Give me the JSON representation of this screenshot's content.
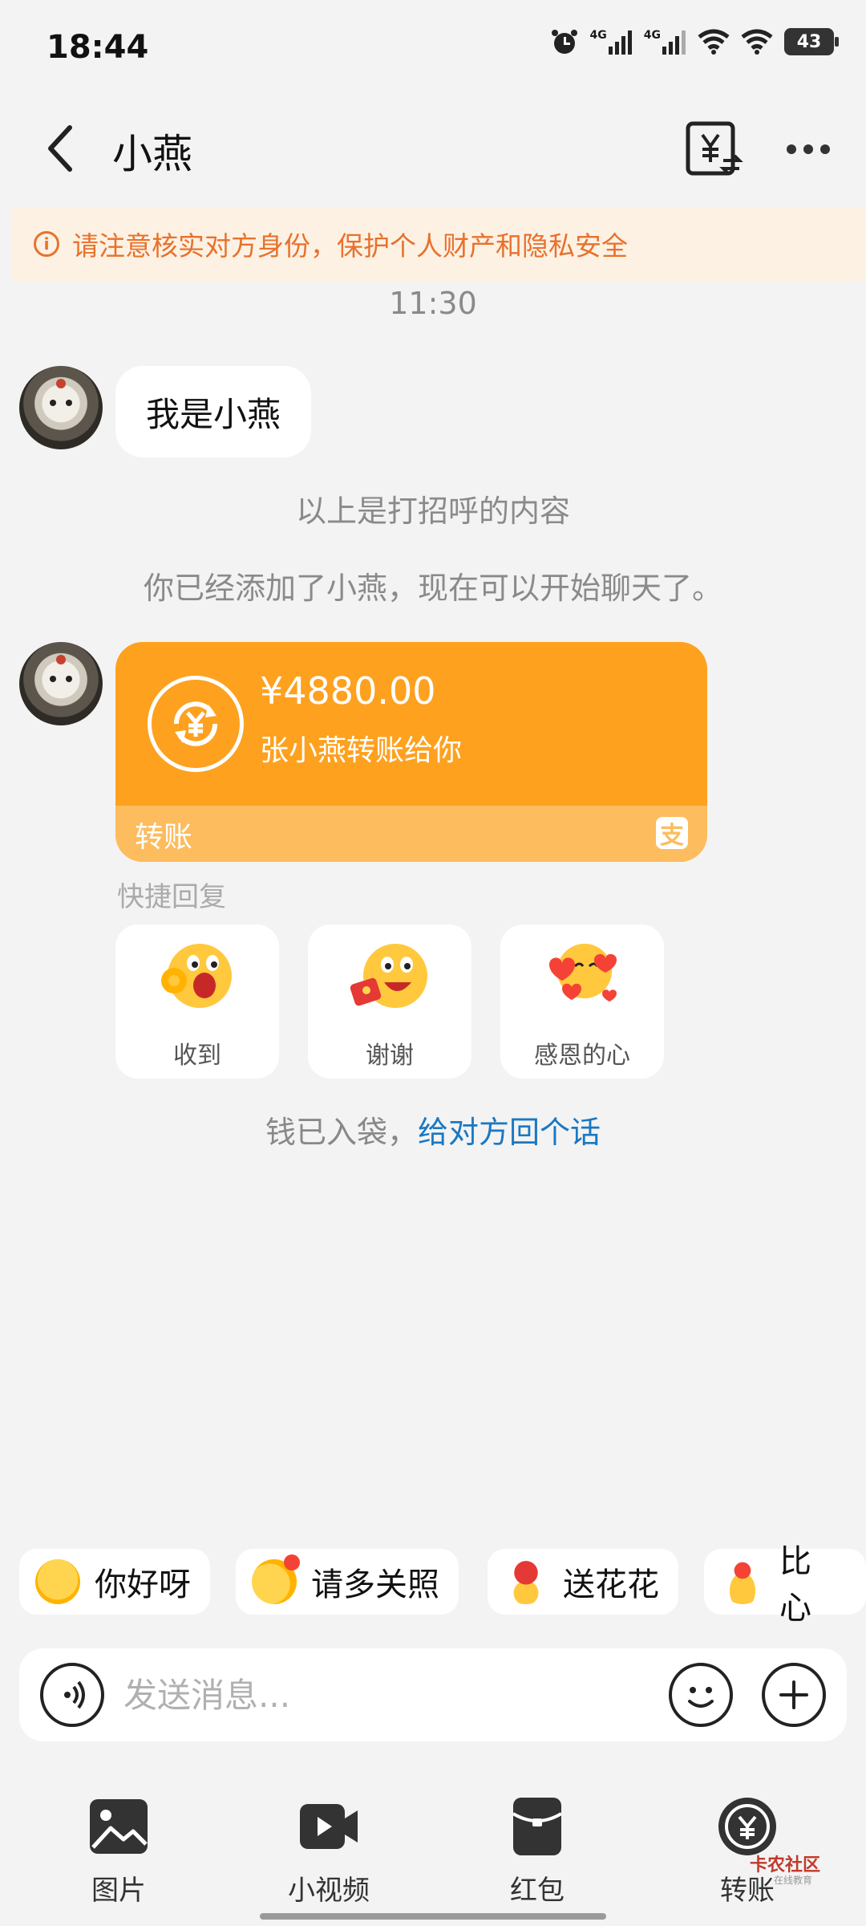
{
  "status_bar": {
    "time": "18:44",
    "battery": "43",
    "network_1": "4G",
    "network_2": "4G"
  },
  "nav": {
    "title": "小燕"
  },
  "warning": {
    "text": "请注意核实对方身份，保护个人财产和隐私安全"
  },
  "chat": {
    "timestamp": "11:30",
    "greeting_message": "我是小燕",
    "system_msg_1": "以上是打招呼的内容",
    "system_msg_2": "你已经添加了小燕，现在可以开始聊天了。"
  },
  "transfer_card": {
    "amount": "¥4880.00",
    "description": "张小燕转账给你",
    "footer_label": "转账",
    "footer_logo_glyph": "支",
    "card_color": "#fea11f",
    "footer_color": "#fdbc5e"
  },
  "quick_reply": {
    "label": "快捷回复",
    "items": [
      {
        "label": "收到",
        "icon": "ok-hand-emoji-icon"
      },
      {
        "label": "谢谢",
        "icon": "thanks-red-envelope-emoji-icon"
      },
      {
        "label": "感恩的心",
        "icon": "hearts-emoji-icon"
      }
    ]
  },
  "money_hint": {
    "text": "钱已入袋，",
    "link": "给对方回个话"
  },
  "chips": [
    {
      "label": "你好呀",
      "icon": "hello-emoji-icon"
    },
    {
      "label": "请多关照",
      "icon": "hug-emoji-icon"
    },
    {
      "label": "送花花",
      "icon": "flower-icon"
    },
    {
      "label": "比心",
      "icon": "finger-heart-icon"
    }
  ],
  "input": {
    "placeholder": "发送消息..."
  },
  "toolbar": {
    "items": [
      {
        "label": "图片",
        "icon": "image-icon"
      },
      {
        "label": "小视频",
        "icon": "video-icon"
      },
      {
        "label": "红包",
        "icon": "red-packet-icon"
      },
      {
        "label": "转账",
        "icon": "transfer-icon"
      }
    ]
  },
  "watermark": {
    "text": "卡农社区",
    "subtext": "在线教育"
  },
  "colors": {
    "accent_link": "#1a78c2",
    "warning": "#e8712c"
  }
}
